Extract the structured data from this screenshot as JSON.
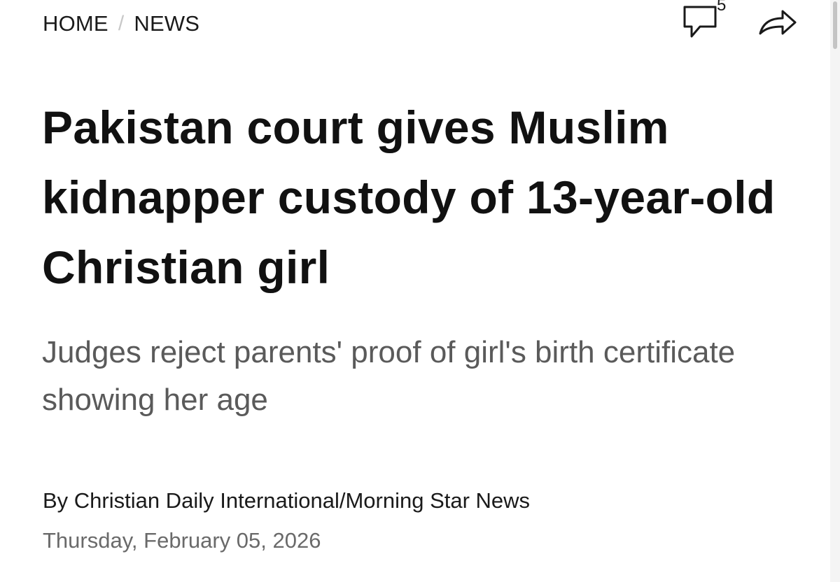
{
  "breadcrumb": {
    "home": "HOME",
    "separator": "/",
    "section": "NEWS"
  },
  "actions": {
    "comment_icon": "speech-bubble-icon",
    "comment_count": "5",
    "share_icon": "share-arrow-icon"
  },
  "article": {
    "headline": "Pakistan court gives Muslim kidnapper custody of 13-year-old Christian girl",
    "subheadline": "Judges reject parents' proof of girl's birth certificate showing her age",
    "byline": "By Christian Daily International/Morning Star News",
    "date": "Thursday, February 05, 2026"
  },
  "colors": {
    "text_primary": "#111111",
    "text_secondary": "#5a5a5a",
    "separator": "#c8c8c8",
    "background": "#ffffff"
  }
}
